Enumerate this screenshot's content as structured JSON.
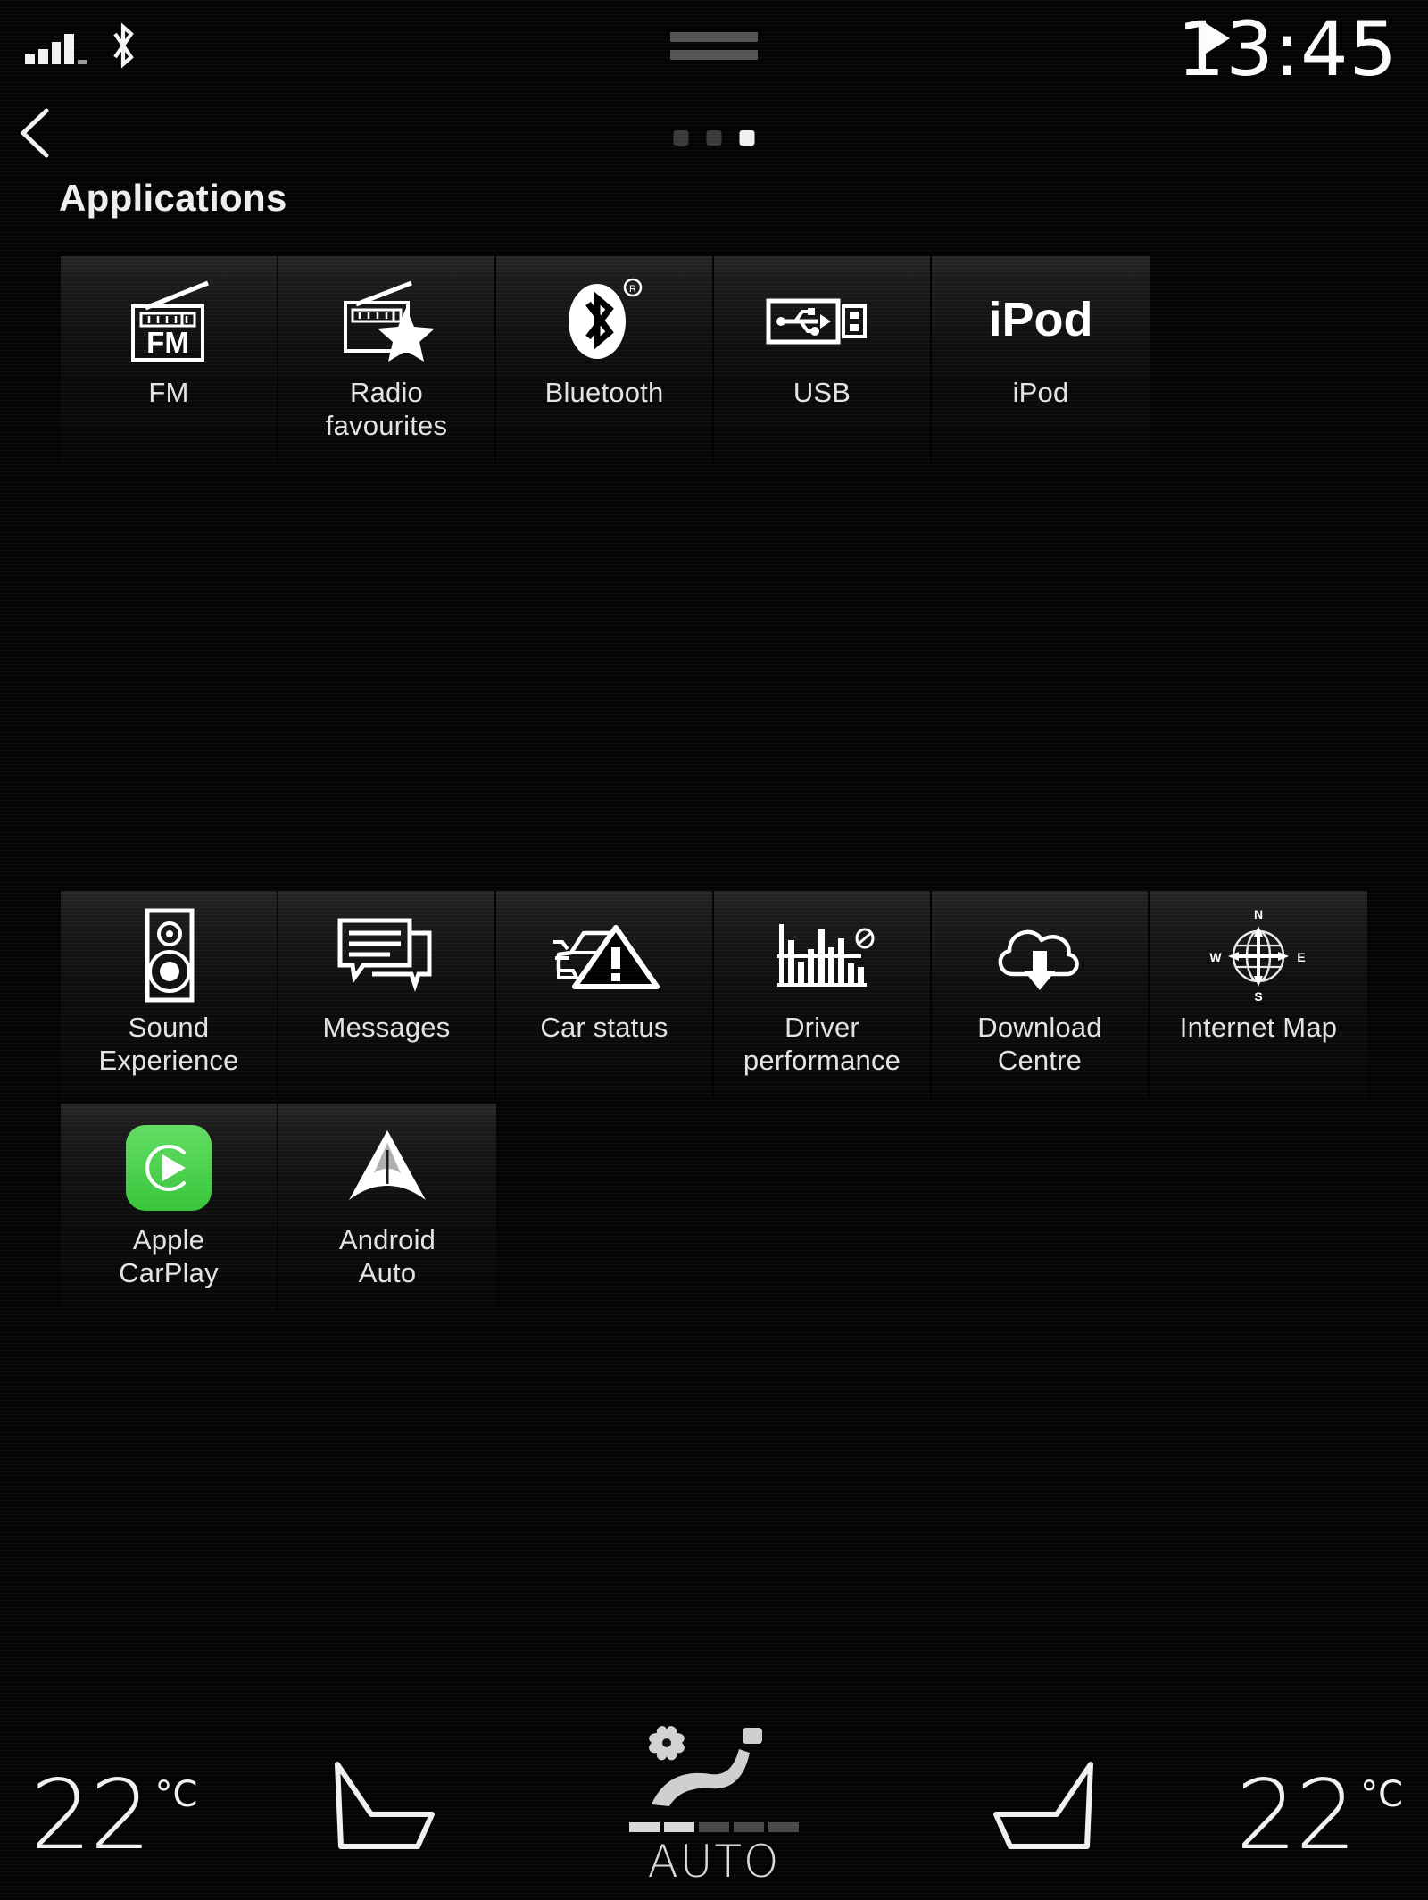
{
  "statusbar": {
    "signal_icon": "signal-bars-icon",
    "signal_bars": 4,
    "bluetooth_icon": "bluetooth-icon",
    "drag_handle_icon": "drag-handle-icon",
    "play_icon": "play-icon",
    "time": "13:45"
  },
  "header": {
    "back_icon": "back-chevron-icon",
    "title": "Applications",
    "pages": {
      "count": 3,
      "active_index": 2
    }
  },
  "apps": {
    "row1": [
      {
        "id": "fm",
        "icon": "fm-radio-icon",
        "icon_text": "FM",
        "label": "FM"
      },
      {
        "id": "radio-favourites",
        "icon": "radio-star-icon",
        "label": "Radio\nfavourites"
      },
      {
        "id": "bluetooth",
        "icon": "bluetooth-icon",
        "badge": "®",
        "label": "Bluetooth"
      },
      {
        "id": "usb",
        "icon": "usb-connector-icon",
        "label": "USB"
      },
      {
        "id": "ipod",
        "icon": "ipod-wordmark-icon",
        "icon_text": "iPod",
        "label": "iPod"
      }
    ],
    "row2": [
      {
        "id": "sound-experience",
        "icon": "speaker-icon",
        "label": "Sound\nExperience"
      },
      {
        "id": "messages",
        "icon": "speech-bubbles-icon",
        "label": "Messages"
      },
      {
        "id": "car-status",
        "icon": "car-warning-icon",
        "label": "Car status"
      },
      {
        "id": "driver-performance",
        "icon": "bar-chart-icon",
        "label": "Driver\nperformance"
      },
      {
        "id": "download-centre",
        "icon": "cloud-download-icon",
        "label": "Download\nCentre"
      },
      {
        "id": "internet-map",
        "icon": "compass-globe-icon",
        "label": "Internet Map"
      }
    ],
    "row3": [
      {
        "id": "apple-carplay",
        "icon": "apple-carplay-icon",
        "label": "Apple\nCarPlay"
      },
      {
        "id": "android-auto",
        "icon": "android-auto-icon",
        "label": "Android\nAuto"
      }
    ]
  },
  "climate": {
    "left_temp": {
      "value": "22",
      "unit": "°C"
    },
    "right_temp": {
      "value": "22",
      "unit": "°C"
    },
    "left_seat_icon": "seat-heater-left-icon",
    "right_seat_icon": "seat-heater-right-icon",
    "auto": {
      "fan_icon": "fan-icon",
      "seat-figure_icon": "seated-person-icon",
      "label": "AUTO",
      "fan_level": 2,
      "fan_segments": 5
    }
  },
  "colors": {
    "background": "#040404",
    "tile_top": "#262626",
    "text": "#e8e8e8",
    "accent_carplay_green": "#45CE45",
    "dot_inactive": "#3a3a3a",
    "dot_active": "#f0f0f0"
  }
}
